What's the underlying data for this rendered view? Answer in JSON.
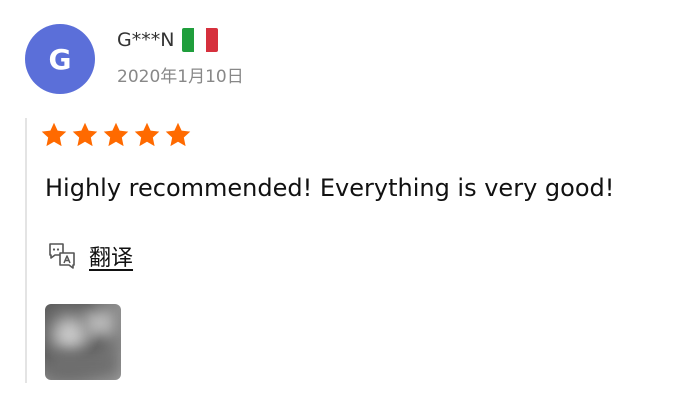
{
  "reviewer": {
    "avatar_initial": "G",
    "avatar_color": "#5b6fd9",
    "name": "G***N",
    "country_flag": "italy-flag",
    "flag_colors": [
      "#1f9e3c",
      "#ffffff",
      "#d6303d"
    ]
  },
  "review": {
    "date": "2020年1月10日",
    "rating": 5,
    "rating_max": 5,
    "star_color": "#ff6a00",
    "text": "Highly recommended!  Everything is very good!"
  },
  "actions": {
    "translate_icon": "translate-icon",
    "translate_label": "翻译"
  },
  "attachments": {
    "photo_count": 1
  }
}
